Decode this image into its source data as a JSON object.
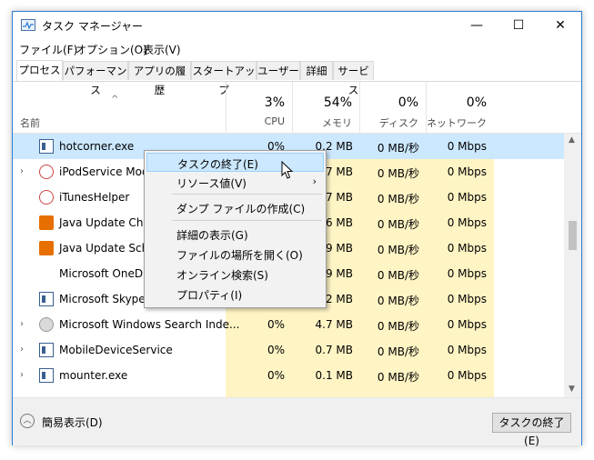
{
  "window": {
    "title": "タスク マネージャー",
    "minimize_glyph": "—",
    "maximize_glyph": "☐",
    "close_glyph": "✕"
  },
  "menu": [
    "ファイル(F)",
    "オプション(O)",
    "表示(V)"
  ],
  "tabs": [
    "プロセス",
    "パフォーマンス",
    "アプリの履歴",
    "スタートアップ",
    "ユーザー",
    "詳細",
    "サービス"
  ],
  "header": {
    "name_label": "名前",
    "cpu": {
      "percent": "3%",
      "label": "CPU"
    },
    "memory": {
      "percent": "54%",
      "label": "メモリ"
    },
    "disk": {
      "percent": "0%",
      "label": "ディスク"
    },
    "network": {
      "percent": "0%",
      "label": "ネットワーク"
    }
  },
  "rows": [
    {
      "name": "hotcorner.exe",
      "cpu": "0%",
      "mem": "0.2 MB",
      "disk": "0 MB/秒",
      "net": "0 Mbps",
      "icon": "app-icon"
    },
    {
      "name": "iPodService Modu",
      "cpu": "",
      "mem": "7 MB",
      "disk": "0 MB/秒",
      "net": "0 Mbps",
      "icon": "itunes-icon"
    },
    {
      "name": "iTunesHelper",
      "cpu": "",
      "mem": "7 MB",
      "disk": "0 MB/秒",
      "net": "0 Mbps",
      "icon": "itunes-icon"
    },
    {
      "name": "Java Update Chec",
      "cpu": "",
      "mem": "6 MB",
      "disk": "0 MB/秒",
      "net": "0 Mbps",
      "icon": "java-icon"
    },
    {
      "name": "Java Update Sche",
      "cpu": "",
      "mem": "9 MB",
      "disk": "0 MB/秒",
      "net": "0 Mbps",
      "icon": "java-icon"
    },
    {
      "name": "Microsoft OneDriv",
      "cpu": "",
      "mem": "9 MB",
      "disk": "0 MB/秒",
      "net": "0 Mbps",
      "icon": "none"
    },
    {
      "name": "Microsoft Skype P",
      "cpu": "",
      "mem": "2 MB",
      "disk": "0 MB/秒",
      "net": "0 Mbps",
      "icon": "app-icon"
    },
    {
      "name": "Microsoft Windows Search Inde...",
      "cpu": "0%",
      "mem": "4.7 MB",
      "disk": "0 MB/秒",
      "net": "0 Mbps",
      "icon": "search-icon"
    },
    {
      "name": "MobileDeviceService",
      "cpu": "0%",
      "mem": "0.7 MB",
      "disk": "0 MB/秒",
      "net": "0 Mbps",
      "icon": "app-icon"
    },
    {
      "name": "mounter.exe",
      "cpu": "0%",
      "mem": "0.1 MB",
      "disk": "0 MB/秒",
      "net": "0 Mbps",
      "icon": "app-icon"
    }
  ],
  "context_menu": [
    {
      "label": "タスクの終了(E)"
    },
    {
      "label": "リソース値(V)",
      "arrow": "›"
    },
    {
      "label": "ダンプ ファイルの作成(C)"
    },
    {
      "label": "詳細の表示(G)"
    },
    {
      "label": "ファイルの場所を開く(O)"
    },
    {
      "label": "オンライン検索(S)"
    },
    {
      "label": "プロパティ(I)"
    }
  ],
  "footer": {
    "fewer_details": "簡易表示(D)",
    "end_task": "タスクの終了(E)"
  },
  "colors": {
    "accent": "#2b7cd3",
    "selection": "#cce8ff",
    "heat": "#fff4c4"
  }
}
